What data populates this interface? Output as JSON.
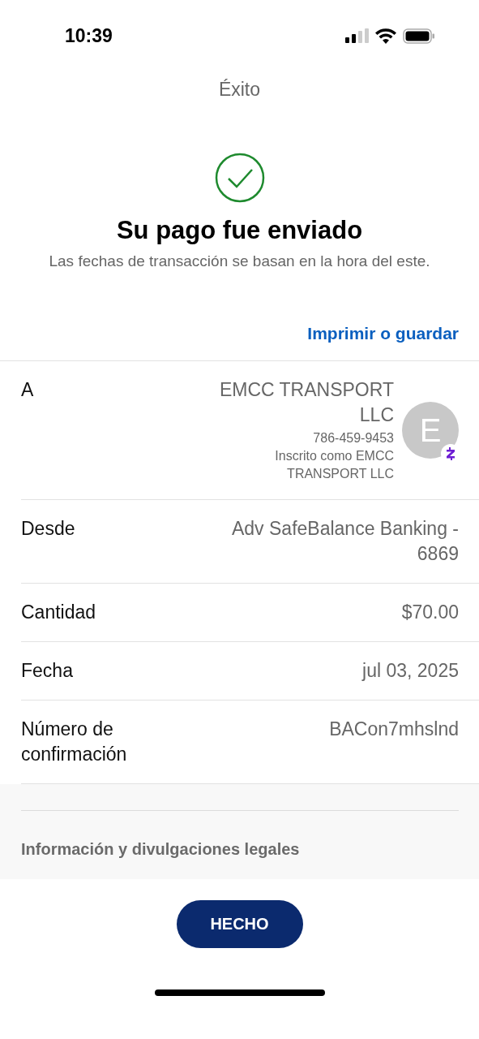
{
  "status_bar": {
    "time": "10:39"
  },
  "title": "Éxito",
  "heading": "Su pago fue enviado",
  "subtitle": "Las fechas de transacción se basan en la hora del este.",
  "print_link": "Imprimir o guardar",
  "details": [
    {
      "kind": "recipient",
      "label": "A",
      "name": "EMCC TRANSPORT LLC",
      "phone": "786-459-9453",
      "enrolled_as": "Inscrito como EMCC TRANSPORT LLC",
      "avatar_initial": "E"
    },
    {
      "kind": "text",
      "label": "Desde",
      "value": "Adv SafeBalance Banking - 6869"
    },
    {
      "kind": "text",
      "label": "Cantidad",
      "value": "$70.00"
    },
    {
      "kind": "text",
      "label": "Fecha",
      "value": "jul 03, 2025"
    },
    {
      "kind": "text",
      "label": "Número de confirmación",
      "value": "BACon7mhslnd"
    }
  ],
  "legal_link": "Información y divulgaciones legales",
  "done_button": "HECHO"
}
